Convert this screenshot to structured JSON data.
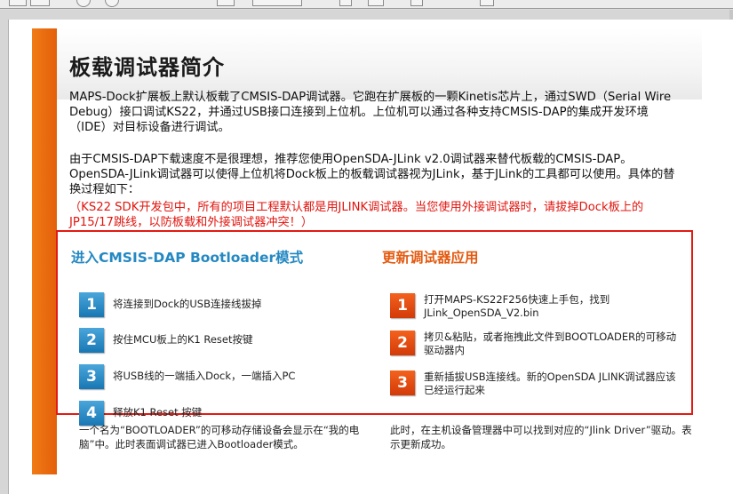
{
  "document": {
    "title": "板载调试器简介",
    "para1": "MAPS-Dock扩展板上默认板载了CMSIS-DAP调试器。它跑在扩展板的一颗Kinetis芯片上，通过SWD（Serial Wire Debug）接口调试KS22，并通过USB接口连接到上位机。上位机可以通过各种支持CMSIS-DAP的集成开发环境（IDE）对目标设备进行调试。",
    "para2": "由于CMSIS-DAP下载速度不是很理想，推荐您使用OpenSDA-JLink v2.0调试器来替代板载的CMSIS-DAP。OpenSDA-JLink调试器可以使得上位机将Dock板上的板载调试器视为JLink，基于JLink的工具都可以使用。具体的替换过程如下：",
    "warning": "（KS22 SDK开发包中，所有的项目工程默认都是用JLINK调试器。当您使用外接调试器时，请拔掉Dock板上的JP15/17跳线，以防板载和外接调试器冲突！）",
    "left_column": {
      "title": "进入CMSIS-DAP Bootloader模式",
      "steps": [
        {
          "num": "1",
          "text": "将连接到Dock的USB连接线拔掉"
        },
        {
          "num": "2",
          "text": "按住MCU板上的K1 Reset按键"
        },
        {
          "num": "3",
          "text": "将USB线的一端插入Dock，一端插入PC"
        },
        {
          "num": "4",
          "text": "释放K1 Reset 按键"
        }
      ],
      "footer": "一个名为“BOOTLOADER”的可移动存储设备会显示在“我的电脑”中。此时表面调试器已进入Bootloader模式。"
    },
    "right_column": {
      "title": "更新调试器应用",
      "steps": [
        {
          "num": "1",
          "text": "打开MAPS-KS22F256快速上手包，找到JLink_OpenSDA_V2.bin"
        },
        {
          "num": "2",
          "text": "拷贝&粘贴，或者拖拽此文件到BOOTLOADER的可移动驱动器内"
        },
        {
          "num": "3",
          "text": "重新插拔USB连接线。新的OpenSDA JLINK调试器应该已经运行起来"
        }
      ],
      "footer": "此时，在主机设备管理器中可以找到对应的“Jlink Driver”驱动。表示更新成功。"
    }
  },
  "colors": {
    "accent_orange": "#e35f0a",
    "accent_blue": "#2488c2",
    "warning_red": "#e0150e",
    "highlight_box": "#e21a12"
  }
}
